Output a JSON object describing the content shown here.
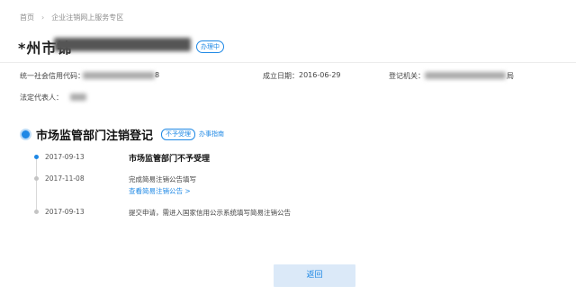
{
  "breadcrumb": {
    "home": "首页",
    "separator": "›",
    "current": "企业注销网上服务专区"
  },
  "company": {
    "name_visible": "*州市锦",
    "status_badge": "办理中"
  },
  "info": {
    "credit_code_label": "统一社会信用代码：",
    "credit_code_tail": "8",
    "established_label": "成立日期：",
    "established_value": "2016-06-29",
    "authority_label": "登记机关：",
    "authority_tail": "局",
    "legal_rep_label": "法定代表人："
  },
  "section": {
    "icon": "dot-circle-icon",
    "title": "市场监管部门注销登记",
    "status_tag": "不予受理",
    "guide_link": "办事指南"
  },
  "timeline": [
    {
      "date": "2017-09-13",
      "title": "市场监管部门不予受理",
      "text": "",
      "link": ""
    },
    {
      "date": "2017-11-08",
      "title": "",
      "text": "完成简易注销公告填写",
      "link": "查看简易注销公告 >"
    },
    {
      "date": "2017-09-13",
      "title": "",
      "text": "提交申请，需进入国家信用公示系统填写简易注销公告",
      "link": ""
    }
  ],
  "colors": {
    "accent": "#1e88e5",
    "button_bg": "#dbe9f8"
  },
  "actions": {
    "back_label": "返回"
  }
}
